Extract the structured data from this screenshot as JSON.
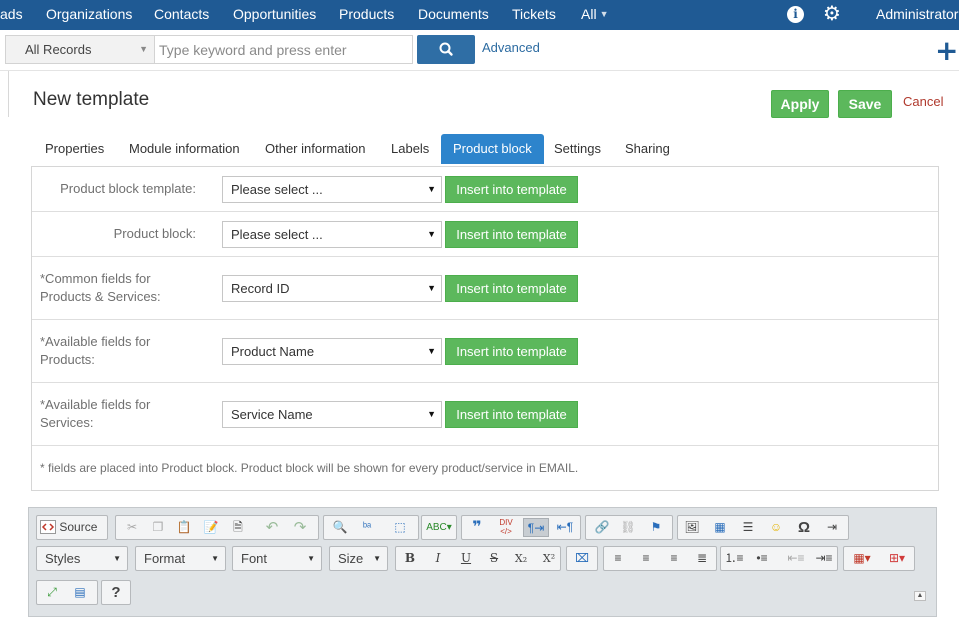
{
  "topnav": {
    "items": [
      "ads",
      "Organizations",
      "Contacts",
      "Opportunities",
      "Products",
      "Documents",
      "Tickets",
      "All"
    ],
    "user": "Administrator",
    "icons": [
      "info-icon",
      "gear-icon"
    ]
  },
  "search": {
    "scope": "All Records",
    "placeholder": "Type keyword and press enter",
    "advanced": "Advanced"
  },
  "header": {
    "title": "New template",
    "apply": "Apply",
    "save": "Save",
    "cancel": "Cancel"
  },
  "tabs": [
    "Properties",
    "Module information",
    "Other information",
    "Labels",
    "Product block",
    "Settings",
    "Sharing"
  ],
  "active_tab": "Product block",
  "form": {
    "rows": [
      {
        "label": "Product block template:",
        "value": "Please select ...",
        "button": "Insert into template"
      },
      {
        "label": "Product block:",
        "value": "Please select ...",
        "button": "Insert into template"
      },
      {
        "label": "*Common fields for Products & Services:",
        "line1": "*Common fields for",
        "line2": "Products & Services:",
        "value": "Record ID",
        "button": "Insert into template"
      },
      {
        "label": "*Available fields for Products:",
        "line1": "*Available fields for",
        "line2": "Products:",
        "value": "Product Name",
        "button": "Insert into template"
      },
      {
        "label": "*Available fields for Services:",
        "line1": "*Available fields for",
        "line2": "Services:",
        "value": "Service Name",
        "button": "Insert into template"
      }
    ],
    "note": "* fields are placed into Product block. Product block will be shown for every product/service in EMAIL."
  },
  "editor": {
    "source": "Source",
    "styles": "Styles",
    "format": "Format",
    "font": "Font",
    "size": "Size",
    "bold": "B",
    "italic": "I",
    "underline": "U",
    "strike": "S",
    "subscript": "X₂",
    "superscript": "X²",
    "omega": "Ω",
    "help": "?",
    "quote": "❞"
  },
  "colors": {
    "nav": "#1f5a94",
    "green": "#5cb85c",
    "tab_active": "#2d84cc",
    "cancel": "#b03a2e"
  }
}
